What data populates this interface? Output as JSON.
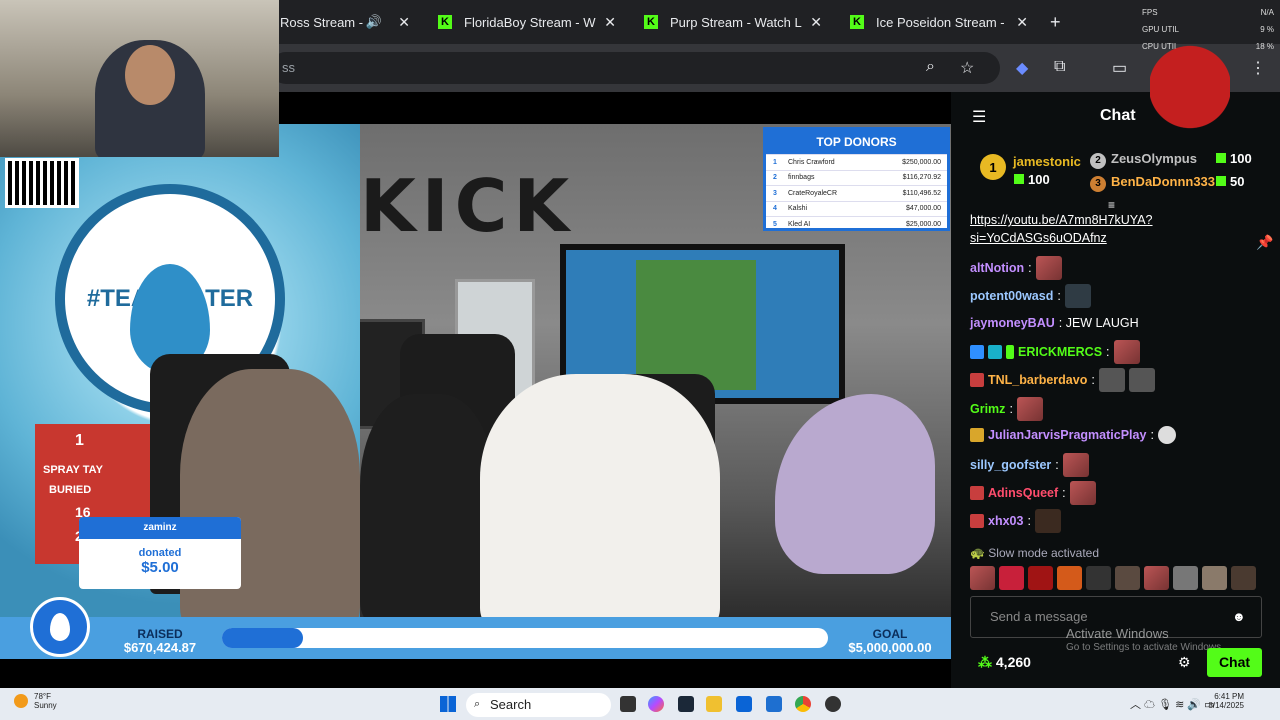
{
  "browser": {
    "tabs": [
      {
        "title": "Ross Stream -",
        "favicon": "none"
      },
      {
        "title": "FloridaBoy Stream - W",
        "favicon": "kick-logo"
      },
      {
        "title": "Purp Stream - Watch L",
        "favicon": "kick-logo"
      },
      {
        "title": "Ice Poseidon Stream -",
        "favicon": "kick-logo"
      }
    ],
    "omnibox_fragment": "ss",
    "new_tab": "+",
    "close_glyph": "✕"
  },
  "perf_overlay": {
    "rows": [
      {
        "label": "FPS",
        "value": "N/A"
      },
      {
        "label": "GPU UTIL",
        "value": "9 %"
      },
      {
        "label": "CPU UTIL",
        "value": "18 %"
      }
    ]
  },
  "stream": {
    "wall_text": "KICK",
    "banner_text": "#TEAMWATER",
    "board_lines": [
      "1",
      "SPRAY TAY",
      "BURIED",
      "16",
      "21"
    ],
    "top_donors": {
      "title": "TOP DONORS",
      "rows": [
        {
          "rank": "1",
          "name": "Chris Crawford",
          "amount": "$250,000.00"
        },
        {
          "rank": "2",
          "name": "finnbags",
          "amount": "$116,270.92"
        },
        {
          "rank": "3",
          "name": "CrateRoyaleCR",
          "amount": "$110,496.52"
        },
        {
          "rank": "4",
          "name": "Kalshi",
          "amount": "$47,000.00"
        },
        {
          "rank": "5",
          "name": "Kled AI",
          "amount": "$25,000.00"
        }
      ]
    },
    "donation": {
      "user": "zaminz",
      "verb": "donated",
      "amount": "$5.00"
    },
    "fundraiser": {
      "raised_label": "RAISED",
      "raised_value": "$670,424.87",
      "goal_label": "GOAL",
      "goal_value": "$5,000,000.00",
      "progress_fraction": 0.134
    }
  },
  "chat": {
    "title": "Chat",
    "leaderboard": [
      {
        "rank": "1",
        "name": "jamestonic",
        "count": "100",
        "color": "#e8b923"
      },
      {
        "rank": "2",
        "name": "ZeusOlympus",
        "count": "100",
        "color": "#c0c0c0"
      },
      {
        "rank": "3",
        "name": "BenDaDonnn333",
        "count": "50",
        "color": "#cd7f32"
      }
    ],
    "link_line1": "https://youtu.be/A7mn8H7kUYA?",
    "link_line2": "si=YoCdASGs6uODAfnz",
    "messages": [
      {
        "user": "altNotion",
        "color": "#c38fff",
        "text": "",
        "emotes": 1
      },
      {
        "user": "potent00wasd",
        "color": "#9cc8ff",
        "text": "",
        "emotes": 1
      },
      {
        "user": "jaymoneyBAU",
        "color": "#c38fff",
        "text": "JEW LAUGH",
        "emotes": 0
      },
      {
        "user": "ERICKMERCS",
        "color": "#53fc18",
        "text": "",
        "emotes": 1
      },
      {
        "user": "TNL_barberdavo",
        "color": "#ffb347",
        "text": "",
        "emotes": 2
      },
      {
        "user": "Grimz",
        "color": "#53fc18",
        "text": "",
        "emotes": 1
      },
      {
        "user": "JulianJarvisPragmaticPlay",
        "color": "#c38fff",
        "text": "",
        "emotes": 1
      },
      {
        "user": "silly_goofster",
        "color": "#9cc8ff",
        "text": "",
        "emotes": 1
      },
      {
        "user": "AdinsQueef",
        "color": "#ff4d6d",
        "text": "",
        "emotes": 1
      },
      {
        "user": "xhx03",
        "color": "#c38fff",
        "text": "",
        "emotes": 1
      }
    ],
    "slow_mode": "Slow mode activated",
    "input_placeholder": "Send a message",
    "watermark_title": "Activate Windows",
    "watermark_sub": "Go to Settings to activate Windows.",
    "points": "4,260",
    "send_button": "Chat"
  },
  "taskbar": {
    "weather_temp": "78°F",
    "weather_desc": "Sunny",
    "search_label": "Search",
    "time": "6:41 PM",
    "date": "8/14/2025"
  }
}
